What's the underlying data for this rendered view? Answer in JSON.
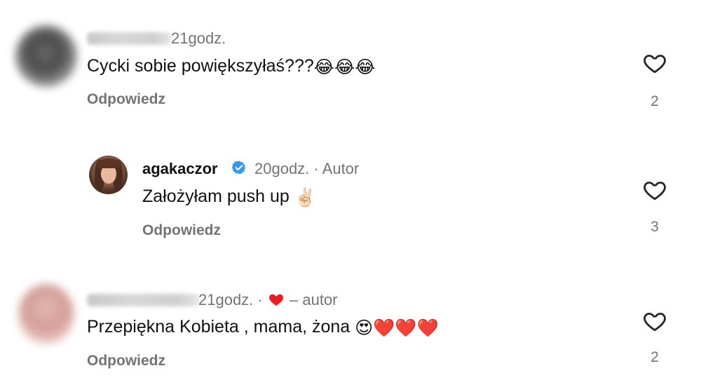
{
  "comments": [
    {
      "username": "",
      "time": "21godz.",
      "text": "Cycki sobie powiększyłaś???",
      "emojis": "😂😂😂",
      "reply_label": "Odpowiedz",
      "likes": "2"
    },
    {
      "username": "agakaczor",
      "time": "20godz.",
      "separator": "·",
      "author_tag": "Autor",
      "text": "Założyłam push up",
      "emojis": "✌🏻",
      "reply_label": "Odpowiedz",
      "likes": "3"
    },
    {
      "username": "",
      "time": "21godz.",
      "separator": "·",
      "author_tag": "– autor",
      "text": "Przepiękna Kobieta , mama, żona",
      "emojis": "😍❤️❤️❤️",
      "reply_label": "Odpowiedz",
      "likes": "2"
    }
  ],
  "colors": {
    "text": "#111111",
    "muted": "#737373",
    "verified": "#3897f0",
    "heart_red": "#ed1c24"
  },
  "icons": {
    "like": "heart-outline-icon",
    "verified": "verified-badge-icon",
    "author_liked": "heart-filled-icon"
  }
}
